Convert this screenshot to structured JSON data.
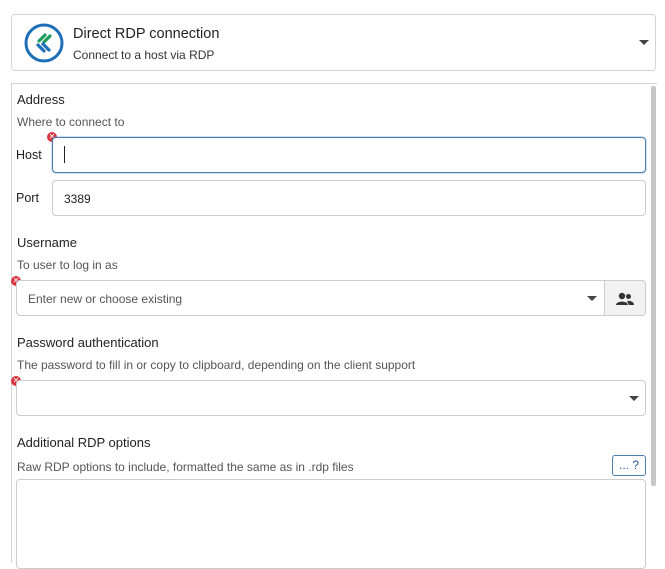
{
  "header": {
    "title": "Direct RDP connection",
    "subtitle": "Connect to a host via RDP",
    "icon": "rdp-connection-icon",
    "accent": "#1f6fb8",
    "icon_green": "#1e9e5a"
  },
  "address": {
    "title": "Address",
    "description": "Where to connect to",
    "host_label": "Host",
    "host_value": "",
    "port_label": "Port",
    "port_value": "3389"
  },
  "username": {
    "title": "Username",
    "description": "To user to log in as",
    "placeholder": "Enter new or choose existing",
    "addon_icon": "user-add-icon"
  },
  "password": {
    "title": "Password authentication",
    "description": "The password to fill in or copy to clipboard, depending on the client support",
    "value": ""
  },
  "rdp_options": {
    "title": "Additional RDP options",
    "description": "Raw RDP options to include, formatted the same as in .rdp files",
    "help_label": "... ?",
    "value": ""
  },
  "colors": {
    "error": "#d9363e",
    "focus_border": "#4a7fb5"
  }
}
